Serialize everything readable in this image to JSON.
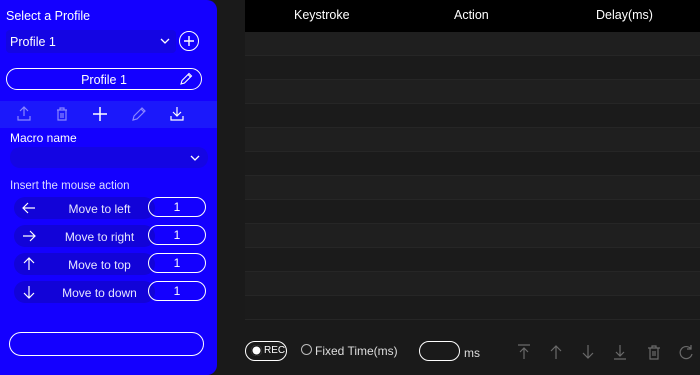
{
  "left_panel": {
    "header": "Select a Profile",
    "profile_select_value": "Profile 1",
    "profile_button_label": "Profile 1",
    "toolbar_icons": [
      "upload-icon",
      "trash-icon",
      "plus-icon",
      "pencil-icon",
      "download-icon"
    ],
    "macro_name_label": "Macro name",
    "macro_name_value": "",
    "insert_label": "Insert the mouse action",
    "mouse_actions": [
      {
        "label": "Move to left",
        "icon": "arrow-left-icon",
        "value": "1"
      },
      {
        "label": "Move to right",
        "icon": "arrow-right-icon",
        "value": "1"
      },
      {
        "label": "Move to top",
        "icon": "arrow-up-icon",
        "value": "1"
      },
      {
        "label": "Move to down",
        "icon": "arrow-down-icon",
        "value": "1"
      }
    ],
    "bottom_button_label": ""
  },
  "table": {
    "columns": [
      "Keystroke",
      "Action",
      "Delay(ms)"
    ],
    "rows": []
  },
  "footer": {
    "rec_label": "REC",
    "fixed_time_label": "Fixed Time(ms)",
    "ms_value": "",
    "ms_label": "ms",
    "controls": [
      "move-to-top-icon",
      "move-up-icon",
      "move-down-icon",
      "move-to-bottom-icon",
      "delete-icon",
      "refresh-icon"
    ]
  },
  "colors": {
    "panel_blue": "#1400ff",
    "background": "#1a1a1a",
    "header_black": "#000000"
  }
}
